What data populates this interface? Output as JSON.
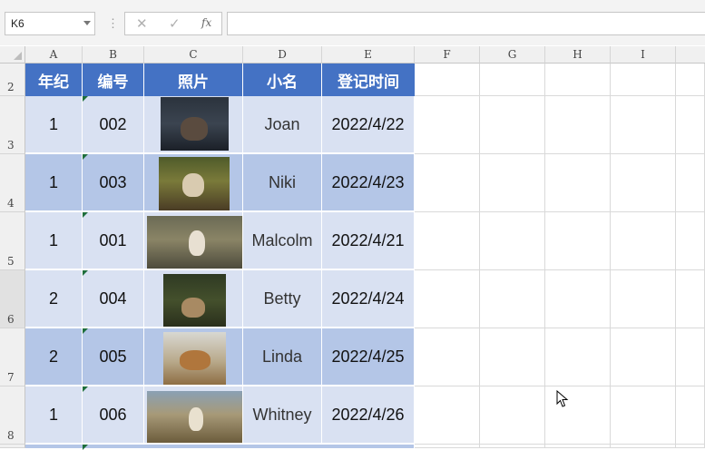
{
  "formula_bar": {
    "name_box": "K6",
    "cancel_icon": "✕",
    "enter_icon": "✓",
    "fx_label": "fx",
    "formula_value": ""
  },
  "columns": [
    "A",
    "B",
    "C",
    "D",
    "E",
    "F",
    "G",
    "H",
    "I"
  ],
  "rows": [
    "2",
    "3",
    "4",
    "5",
    "6",
    "7",
    "8"
  ],
  "table": {
    "headers": [
      "年纪",
      "编号",
      "照片",
      "小名",
      "登记时间"
    ],
    "records": [
      {
        "grade": "1",
        "id": "002",
        "name": "Joan",
        "date": "2022/4/22"
      },
      {
        "grade": "1",
        "id": "003",
        "name": "Niki",
        "date": "2022/4/23"
      },
      {
        "grade": "1",
        "id": "001",
        "name": "Malcolm",
        "date": "2022/4/21"
      },
      {
        "grade": "2",
        "id": "004",
        "name": "Betty",
        "date": "2022/4/24"
      },
      {
        "grade": "2",
        "id": "005",
        "name": "Linda",
        "date": "2022/4/25"
      },
      {
        "grade": "1",
        "id": "006",
        "name": "Whitney",
        "date": "2022/4/26"
      }
    ]
  },
  "colors": {
    "header_fill": "#4472c4",
    "band_light": "#d9e1f2",
    "band_dark": "#b4c6e7",
    "error_flag": "#1e6e3c"
  },
  "icons": [
    "dropdown-arrow-icon",
    "cancel-icon",
    "enter-icon",
    "function-icon",
    "select-all-icon",
    "mouse-cursor-icon"
  ]
}
